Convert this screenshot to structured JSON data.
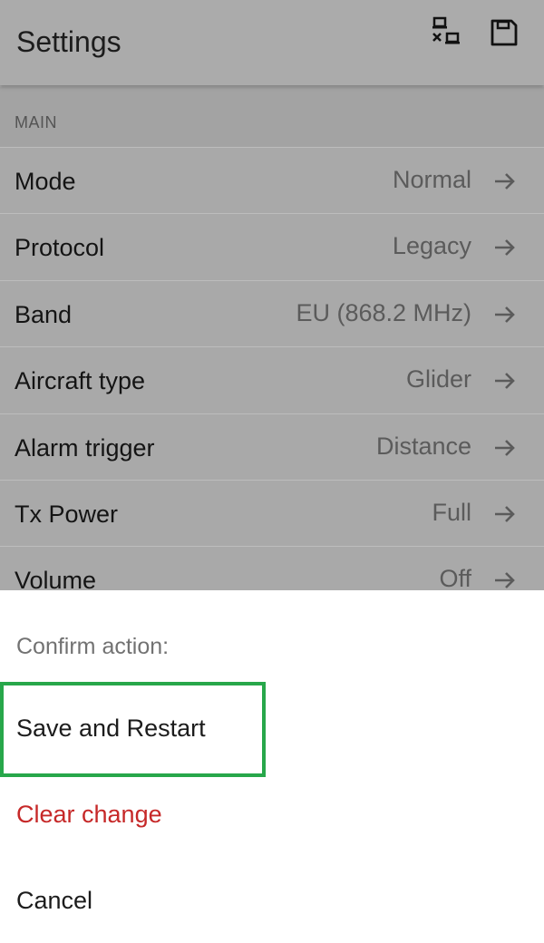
{
  "appbar": {
    "title": "Settings",
    "actions": [
      {
        "icon": "disconnect-icon"
      },
      {
        "icon": "save-icon"
      }
    ]
  },
  "section": {
    "header": "MAIN"
  },
  "settings": [
    {
      "label": "Mode",
      "value": "Normal"
    },
    {
      "label": "Protocol",
      "value": "Legacy"
    },
    {
      "label": "Band",
      "value": "EU (868.2 MHz)"
    },
    {
      "label": "Aircraft type",
      "value": "Glider"
    },
    {
      "label": "Alarm trigger",
      "value": "Distance"
    },
    {
      "label": "Tx Power",
      "value": "Full"
    },
    {
      "label": "Volume",
      "value": "Off"
    }
  ],
  "sheet": {
    "title": "Confirm action:",
    "items": [
      {
        "label": "Save and Restart"
      },
      {
        "label": "Clear change"
      },
      {
        "label": "Cancel"
      }
    ]
  },
  "colors": {
    "highlight": "#27a74a",
    "destructive": "#c62828",
    "scrim_background": "#a9a9a9"
  }
}
